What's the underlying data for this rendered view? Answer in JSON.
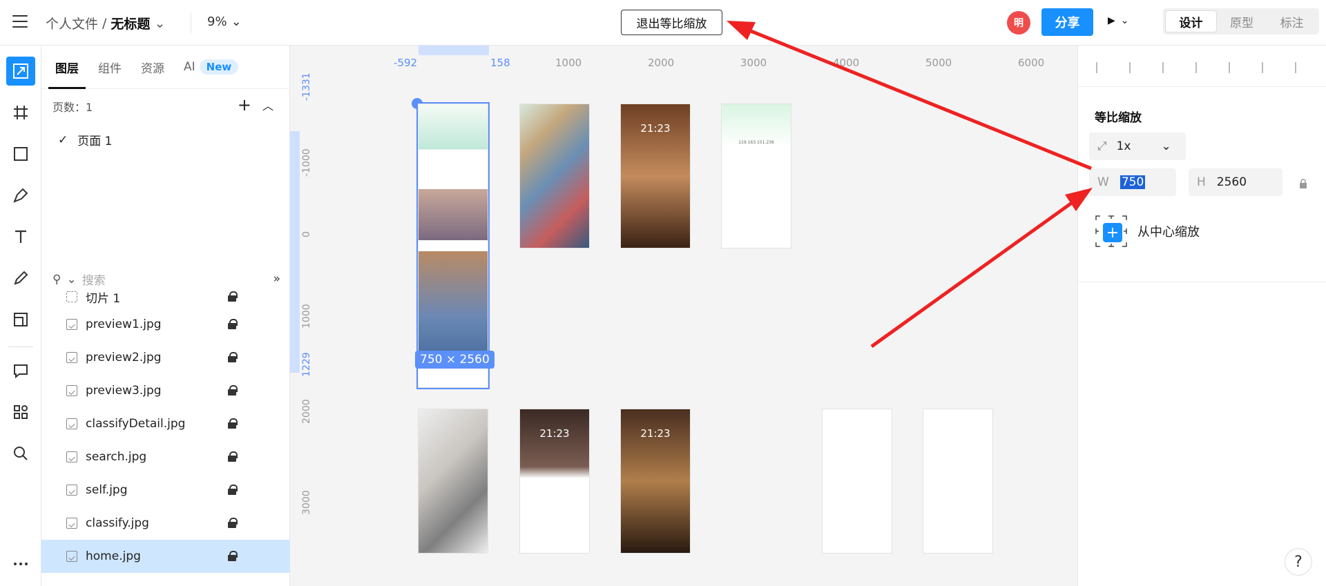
{
  "header": {
    "breadcrumb_parent": "个人文件",
    "breadcrumb_sep": "/",
    "title": "无标题",
    "zoom": "9%",
    "exit_button": "退出等比缩放",
    "avatar": "明",
    "share": "分享",
    "modes": [
      "设计",
      "原型",
      "标注"
    ],
    "active_mode": "设计"
  },
  "toolbar": {
    "tools": [
      "scale-icon",
      "frame-icon",
      "rectangle-icon",
      "pen-icon",
      "text-icon",
      "pencil-icon",
      "slice-icon",
      "comment-icon",
      "plugins-icon",
      "search-icon",
      "more-icon"
    ],
    "active": "scale-icon"
  },
  "layers_panel": {
    "tabs": [
      "图层",
      "组件",
      "资源",
      "AI"
    ],
    "ai_badge": "New",
    "pages_label": "页数：1",
    "pages": [
      "页面 1"
    ],
    "search_placeholder": "搜索",
    "layers": [
      {
        "name": "切片 1",
        "type": "slice"
      },
      {
        "name": "preview1.jpg",
        "type": "image"
      },
      {
        "name": "preview2.jpg",
        "type": "image"
      },
      {
        "name": "preview3.jpg",
        "type": "image"
      },
      {
        "name": "classifyDetail.jpg",
        "type": "image"
      },
      {
        "name": "search.jpg",
        "type": "image"
      },
      {
        "name": "self.jpg",
        "type": "image"
      },
      {
        "name": "classify.jpg",
        "type": "image"
      },
      {
        "name": "home.jpg",
        "type": "image",
        "selected": true
      }
    ]
  },
  "canvas": {
    "ruler_x": [
      "-592",
      "158",
      "1000",
      "2000",
      "3000",
      "4000",
      "5000",
      "6000"
    ],
    "ruler_y": [
      "-1331",
      "-1000",
      "0",
      "1000",
      "1229",
      "2000",
      "3000"
    ],
    "selection_size": "750 × 2560",
    "phone_times": [
      "21:23",
      "21:23",
      "21:23",
      "119.163.151.236"
    ]
  },
  "properties": {
    "section_title": "等比缩放",
    "scale_value": "1x",
    "w_label": "W",
    "w_value": "750",
    "h_label": "H",
    "h_value": "2560",
    "from_center_label": "从中心缩放"
  },
  "help": "?",
  "colors": {
    "accent": "#1890ff",
    "selection": "#5b8ff9",
    "arrow": "#ee2222",
    "avatar": "#ef4c4c"
  }
}
